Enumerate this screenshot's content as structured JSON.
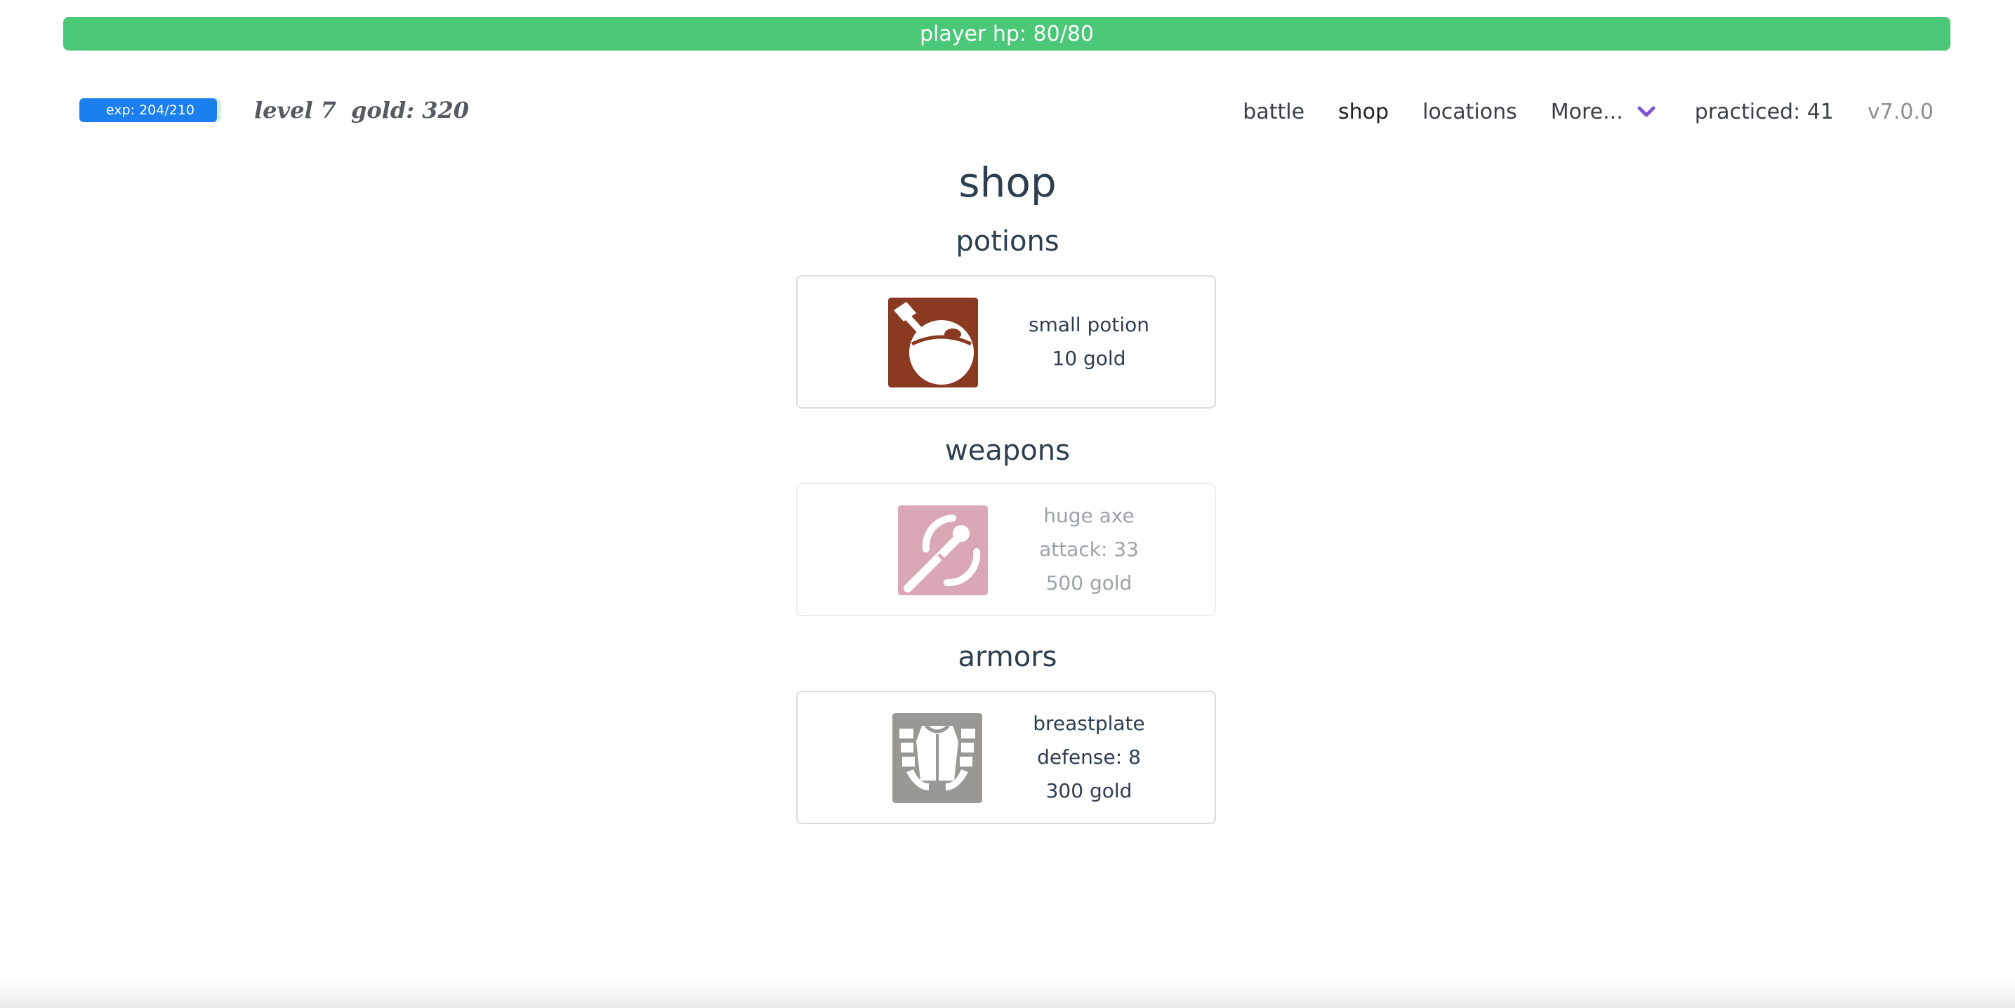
{
  "header": {
    "hp_label": "player hp: 80/80",
    "hp_fraction": 1.0,
    "exp_label": "exp: 204/210",
    "exp_fraction": 0.971,
    "level": "level 7",
    "gold": "gold: 320"
  },
  "nav": {
    "items": [
      "battle",
      "shop",
      "locations"
    ],
    "active": "shop",
    "more_label": "More...",
    "practiced": "practiced: 41",
    "version": "v7.0.0"
  },
  "page": {
    "title": "shop",
    "sections": [
      {
        "title": "potions",
        "items": [
          {
            "icon": "potion-icon",
            "lines": [
              "small potion",
              "10 gold"
            ],
            "color": "#8b3a22",
            "disabled": false
          }
        ]
      },
      {
        "title": "weapons",
        "items": [
          {
            "icon": "axe-icon",
            "lines": [
              "huge axe",
              "attack: 33",
              "500 gold"
            ],
            "color": "#d9a7b6",
            "disabled": true
          }
        ]
      },
      {
        "title": "armors",
        "items": [
          {
            "icon": "breastplate-icon",
            "lines": [
              "breastplate",
              "defense: 8",
              "300 gold"
            ],
            "color": "#9a9895",
            "disabled": false
          }
        ]
      }
    ]
  },
  "colors": {
    "hp_bar": "#4ac777",
    "exp_bar": "#1b7ff0",
    "chevron": "#7b57d1"
  }
}
